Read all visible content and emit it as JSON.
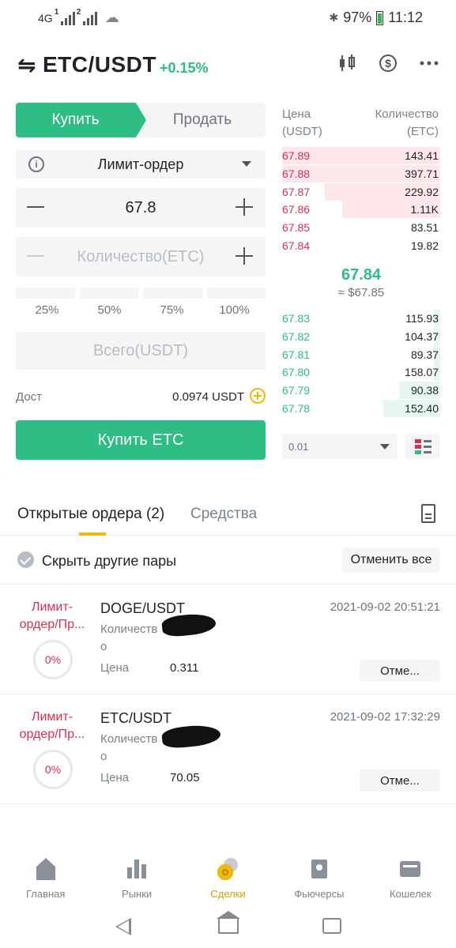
{
  "status_bar": {
    "network": "4G",
    "sim1": "1",
    "sim2": "2",
    "battery": "97%",
    "time": "11:12"
  },
  "header": {
    "pair": "ETC/USDT",
    "change": "+0.15%",
    "icons": [
      "swap-icon",
      "candlestick-icon",
      "dollar-icon",
      "more-icon"
    ]
  },
  "form": {
    "buy_tab": "Купить",
    "sell_tab": "Продать",
    "order_type": "Лимит-ордер",
    "price": "67.8",
    "quantity_placeholder": "Количество(ETC)",
    "percentages": [
      "25%",
      "50%",
      "75%",
      "100%"
    ],
    "total_placeholder": "Всего(USDT)",
    "available_label": "Дост",
    "available_value": "0.0974 USDT",
    "submit": "Купить ETC"
  },
  "order_book": {
    "price_header": [
      "Цена",
      "(USDT)"
    ],
    "qty_header": [
      "Количество",
      "(ETC)"
    ],
    "asks": [
      {
        "price": "67.89",
        "qty": "143.41",
        "depth": 1.0
      },
      {
        "price": "67.88",
        "qty": "397.71",
        "depth": 1.0
      },
      {
        "price": "67.87",
        "qty": "229.92",
        "depth": 0.73
      },
      {
        "price": "67.86",
        "qty": "1.11K",
        "depth": 0.62
      },
      {
        "price": "67.85",
        "qty": "83.51",
        "depth": 0
      },
      {
        "price": "67.84",
        "qty": "19.82",
        "depth": 0
      }
    ],
    "last_price": "67.84",
    "last_price_fiat": "≈ $67.85",
    "bids": [
      {
        "price": "67.83",
        "qty": "115.93",
        "depth": 0.04
      },
      {
        "price": "67.82",
        "qty": "104.37",
        "depth": 0.04
      },
      {
        "price": "67.81",
        "qty": "89.37",
        "depth": 0.04
      },
      {
        "price": "67.80",
        "qty": "158.07",
        "depth": 0.04
      },
      {
        "price": "67.79",
        "qty": "90.38",
        "depth": 0.26
      },
      {
        "price": "67.78",
        "qty": "152.40",
        "depth": 0.36
      }
    ],
    "precision": "0.01"
  },
  "orders": {
    "open_tab": "Открытые ордера (2)",
    "funds_tab": "Средства",
    "hide_other_pairs": "Скрыть другие пары",
    "cancel_all": "Отменить все",
    "list": [
      {
        "type": "Лимит-ордер/Пр...",
        "percent": "0%",
        "symbol": "DOGE/USDT",
        "date": "2021-09-02 20:51:21",
        "qty_label": "Количество",
        "price_label": "Цена",
        "price": "0.311",
        "cancel": "Отме..."
      },
      {
        "type": "Лимит-ордер/Пр...",
        "percent": "0%",
        "symbol": "ETC/USDT",
        "date": "2021-09-02 17:32:29",
        "qty_label": "Количество",
        "price_label": "Цена",
        "price": "70.05",
        "cancel": "Отме..."
      }
    ]
  },
  "bottom_nav": {
    "items": [
      {
        "label": "Главная",
        "icon": "home-icon"
      },
      {
        "label": "Рынки",
        "icon": "markets-icon"
      },
      {
        "label": "Сделки",
        "icon": "trades-icon",
        "active": true
      },
      {
        "label": "Фьючерсы",
        "icon": "futures-icon"
      },
      {
        "label": "Кошелек",
        "icon": "wallet-icon"
      }
    ]
  },
  "colors": {
    "buy": "#2ebd85",
    "sell": "#d9304e",
    "accent": "#f0b90b"
  }
}
